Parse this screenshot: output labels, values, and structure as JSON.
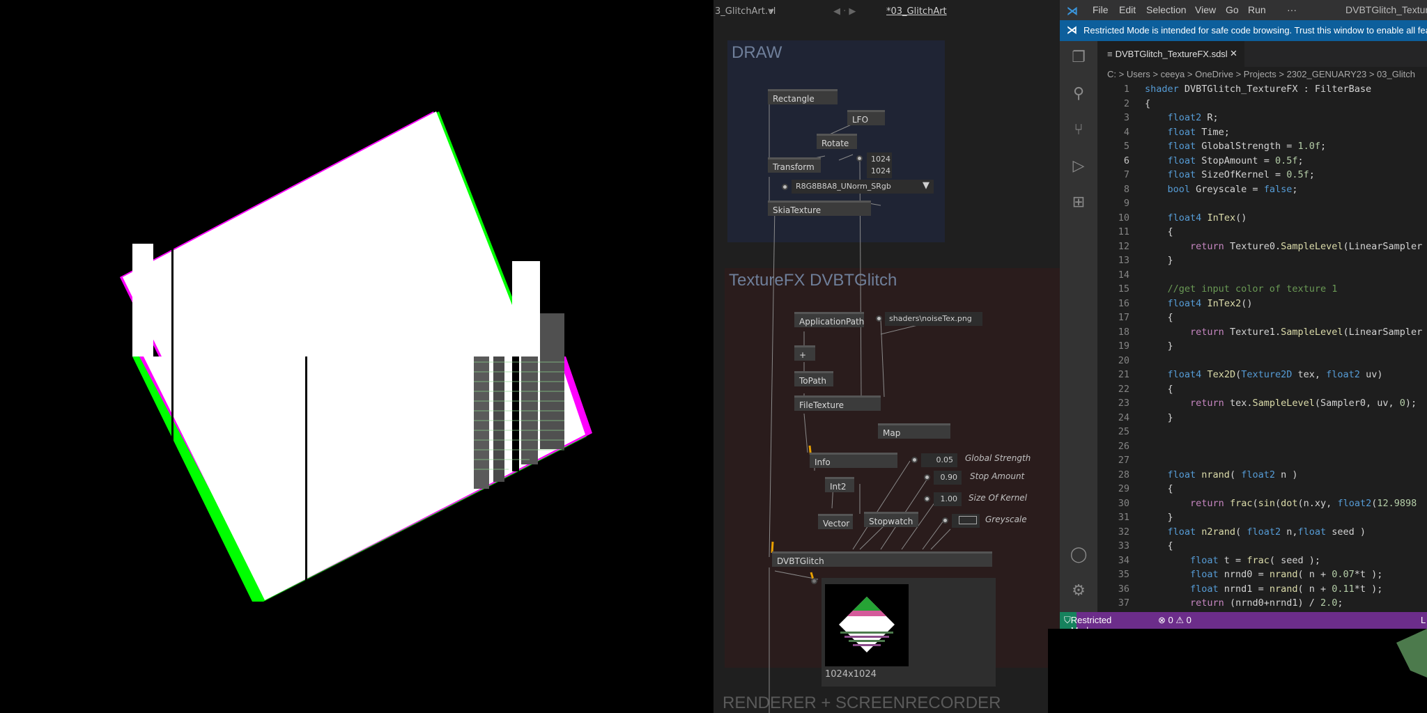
{
  "vvvv": {
    "file_title": "3_GlitchArt.vl",
    "doc_title": "*03_GlitchArt",
    "regions": {
      "draw": "DRAW",
      "texturefx": "TextureFX DVBTGlitch",
      "renderer": "RENDERER + SCREENRECORDER"
    },
    "nodes": {
      "rectangle": "Rectangle",
      "lfo": "LFO",
      "rotate": "Rotate",
      "transform": "Transform",
      "skiatexture": "SkiaTexture",
      "applicationpath": "ApplicationPath",
      "plus": "+",
      "topath": "ToPath",
      "filetexture": "FileTexture",
      "map": "Map",
      "info": "Info",
      "int2": "Int2",
      "vector": "Vector",
      "stopwatch": "Stopwatch",
      "dvbtglitch": "DVBTGlitch"
    },
    "iobox": {
      "size_a": "1024",
      "size_b": "1024",
      "format": "R8G8B8A8_UNorm_SRgb",
      "noise_path": "shaders\\noiseTex.png",
      "global_strength": "0.05",
      "stop_amount": "0.90",
      "size_of_kernel": "1.00"
    },
    "labels": {
      "global_strength": "Global Strength",
      "stop_amount": "Stop Amount",
      "size_of_kernel": "Size Of Kernel",
      "greyscale": "Greyscale"
    },
    "preview_size": "1024x1024"
  },
  "vscode": {
    "menu": [
      "File",
      "Edit",
      "Selection",
      "View",
      "Go",
      "Run",
      "···"
    ],
    "window_title": "DVBTGlitch_TextureF",
    "banner": "Restricted Mode is intended for safe code browsing. Trust this window to enable all fea",
    "tab_label": "DVBTGlitch_TextureFX.sdsl",
    "tab_close": "✕",
    "breadcrumb": "C: > Users > ceeya > OneDrive > Projects > 2302_GENUARY23 > 03_Glitch",
    "status": {
      "restricted": "Restricted Mode",
      "problems": "⊗ 0 ⚠ 0",
      "right": "L"
    },
    "code_lines": [
      "shader DVBTGlitch_TextureFX : FilterBase",
      "{",
      "    float2 R;",
      "    float Time;",
      "    float GlobalStrength = 1.0f;",
      "    float StopAmount = 0.5f;",
      "    float SizeOfKernel = 0.5f;",
      "    bool Greyscale = false;",
      "",
      "    float4 InTex()",
      "    {",
      "        return Texture0.SampleLevel(LinearSampler",
      "    }",
      "",
      "    //get input color of texture 1",
      "    float4 InTex2()",
      "    {",
      "        return Texture1.SampleLevel(LinearSampler",
      "    }",
      "",
      "    float4 Tex2D(Texture2D tex, float2 uv)",
      "    {",
      "        return tex.SampleLevel(Sampler0, uv, 0);",
      "    }",
      "",
      "",
      "",
      "    float nrand( float2 n )",
      "    {",
      "        return frac(sin(dot(n.xy, float2(12.9898",
      "    }",
      "    float n2rand( float2 n,float seed )",
      "    {",
      "        float t = frac( seed );",
      "        float nrnd0 = nrand( n + 0.07*t );",
      "        float nrnd1 = nrand( n + 0.11*t );",
      "        return (nrnd0+nrnd1) / 2.0;"
    ]
  }
}
